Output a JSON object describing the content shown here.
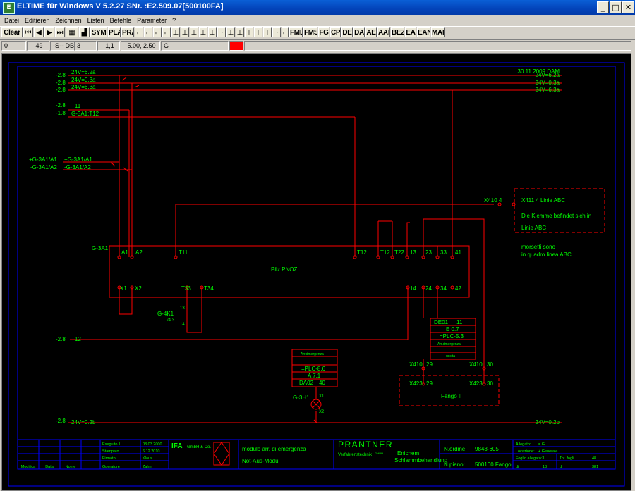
{
  "window": {
    "title": "ELTIME für Windows V 5.2.27 SNr. :E2.509.07[500100FA]"
  },
  "menu": [
    "Datei",
    "Editieren",
    "Zeichnen",
    "Listen",
    "Befehle",
    "Parameter",
    "?"
  ],
  "toolbar": {
    "clear": "Clear",
    "sym": "SYM",
    "pla": "PLA",
    "pra": "PRA",
    "fml": "FML",
    "fms": "FMS",
    "fg": "FG",
    "cp": "CP",
    "de": "DE",
    "da": "DA",
    "ae": "AE",
    "aan": "AAN",
    "bez": "BEZ",
    "ea": "EA",
    "ean": "EAN",
    "man": "MAN"
  },
  "status": {
    "f1": "0",
    "f2": "49",
    "f3": "-S-- DBF",
    "f4": "3",
    "f5": "1,1",
    "f6": "5.00, 2.50",
    "f7": "G"
  },
  "colors": {
    "wire": "#ff0000",
    "label": "#00ff00",
    "frame": "#0000ff",
    "bg": "#000000",
    "frame_text": "#00ff00"
  },
  "schematic": {
    "date": "30.11.2009 DAM",
    "left_refs": [
      "-2.8",
      "-2.8",
      "-2.8",
      "-2.8",
      "-1.8"
    ],
    "bus_left": [
      "24V=6.2a",
      "24V=0.3a",
      "24V=6.3a",
      "T11",
      "G-3A1:T12"
    ],
    "bus_right": [
      "24V=6.2a",
      "24V=0.3a",
      "24V=6.3a"
    ],
    "ga_left": [
      "+G-3A1/A1",
      "-G-3A1/A2"
    ],
    "ga_mid": [
      "+G-3A1/A1",
      "-G-3A1/A2"
    ],
    "pnoz_name": "G-3A1",
    "pnoz_title": "Pilz PNOZ",
    "pnoz_top": [
      "A1",
      "A2",
      "T11",
      "T12",
      "T12",
      "T22",
      "13",
      "23",
      "33",
      "41"
    ],
    "pnoz_bottom": [
      "X1",
      "X2",
      "T33",
      "T34",
      "14",
      "24",
      "34",
      "42"
    ],
    "relay": {
      "name": "G-4K1",
      "sub": "/4.3",
      "t13": "13",
      "t14": "14"
    },
    "x410_4": "X410   4",
    "x411": "X411   4 Linie ABC",
    "note1": "Die Klemme befindet sich in",
    "note2": "Linie ABC",
    "note3": "morsetti sono",
    "note4": "in quadro linea ABC",
    "t12_ref": "-2.8",
    "t12_label": "T12",
    "de01": {
      "l1": "DE01",
      "l1b": "11",
      "l2": "E 0.7",
      "l3": "=PLC-5.3",
      "l4": "Arr.dmergenza",
      "l5": "uscita"
    },
    "da02": {
      "head": "Arr.dmergenza",
      "l1": "=PLC-8.6",
      "l2": "A 7.1",
      "l3": "DA02",
      "l3b": "40"
    },
    "lamp": {
      "name": "G-3H1",
      "x1": "X1",
      "x2": "X2"
    },
    "x410_29": "X410",
    "n29": "29",
    "x410_30": "X410",
    "n30": "30",
    "x423_29": "X423",
    "m29": "29",
    "x423_30": "X423",
    "m30": "30",
    "fango": "Fango II",
    "bottom_ref": "-2.8",
    "bottom_left": "24V=0.2b",
    "bottom_right": "24V=0.2b"
  },
  "titleblock": {
    "col_heads": [
      "Modifica",
      "Data",
      "Nome",
      "Operatore",
      "Zahn"
    ],
    "rows_label": [
      "Eseguito il",
      "Stampato",
      "Firmato"
    ],
    "rows_val": [
      "03.03.2000",
      "6.12.2010",
      "Klaus"
    ],
    "company": "IFA",
    "company_sub": "GmbH & Co.",
    "desc1": "modulo arr. di emergenza",
    "desc2": "Not-Aus-Modul",
    "prantner": "PRANTNER",
    "prantner_sub": "Verfahrenstechnik",
    "gmbh": "GMBH",
    "job1": "Enichem",
    "job2": "Schlammbehandlung",
    "ordine_lbl": "N.ordine:",
    "ordine_val": "9843-605",
    "npiano_lbl": "N.piano:",
    "npiano_val": "500100 Fango",
    "r1_lbl": "Allegato:",
    "r1_val": "= G",
    "r2_lbl": "Locazione:",
    "r2_val": "+ Generale",
    "r3_lbl": "Foglio allegato:3",
    "r3_mid": "Tot. fogli",
    "r3_val": "48",
    "r4a": "di",
    "r4b": "13",
    "r4c": "di",
    "r4d": "381"
  }
}
